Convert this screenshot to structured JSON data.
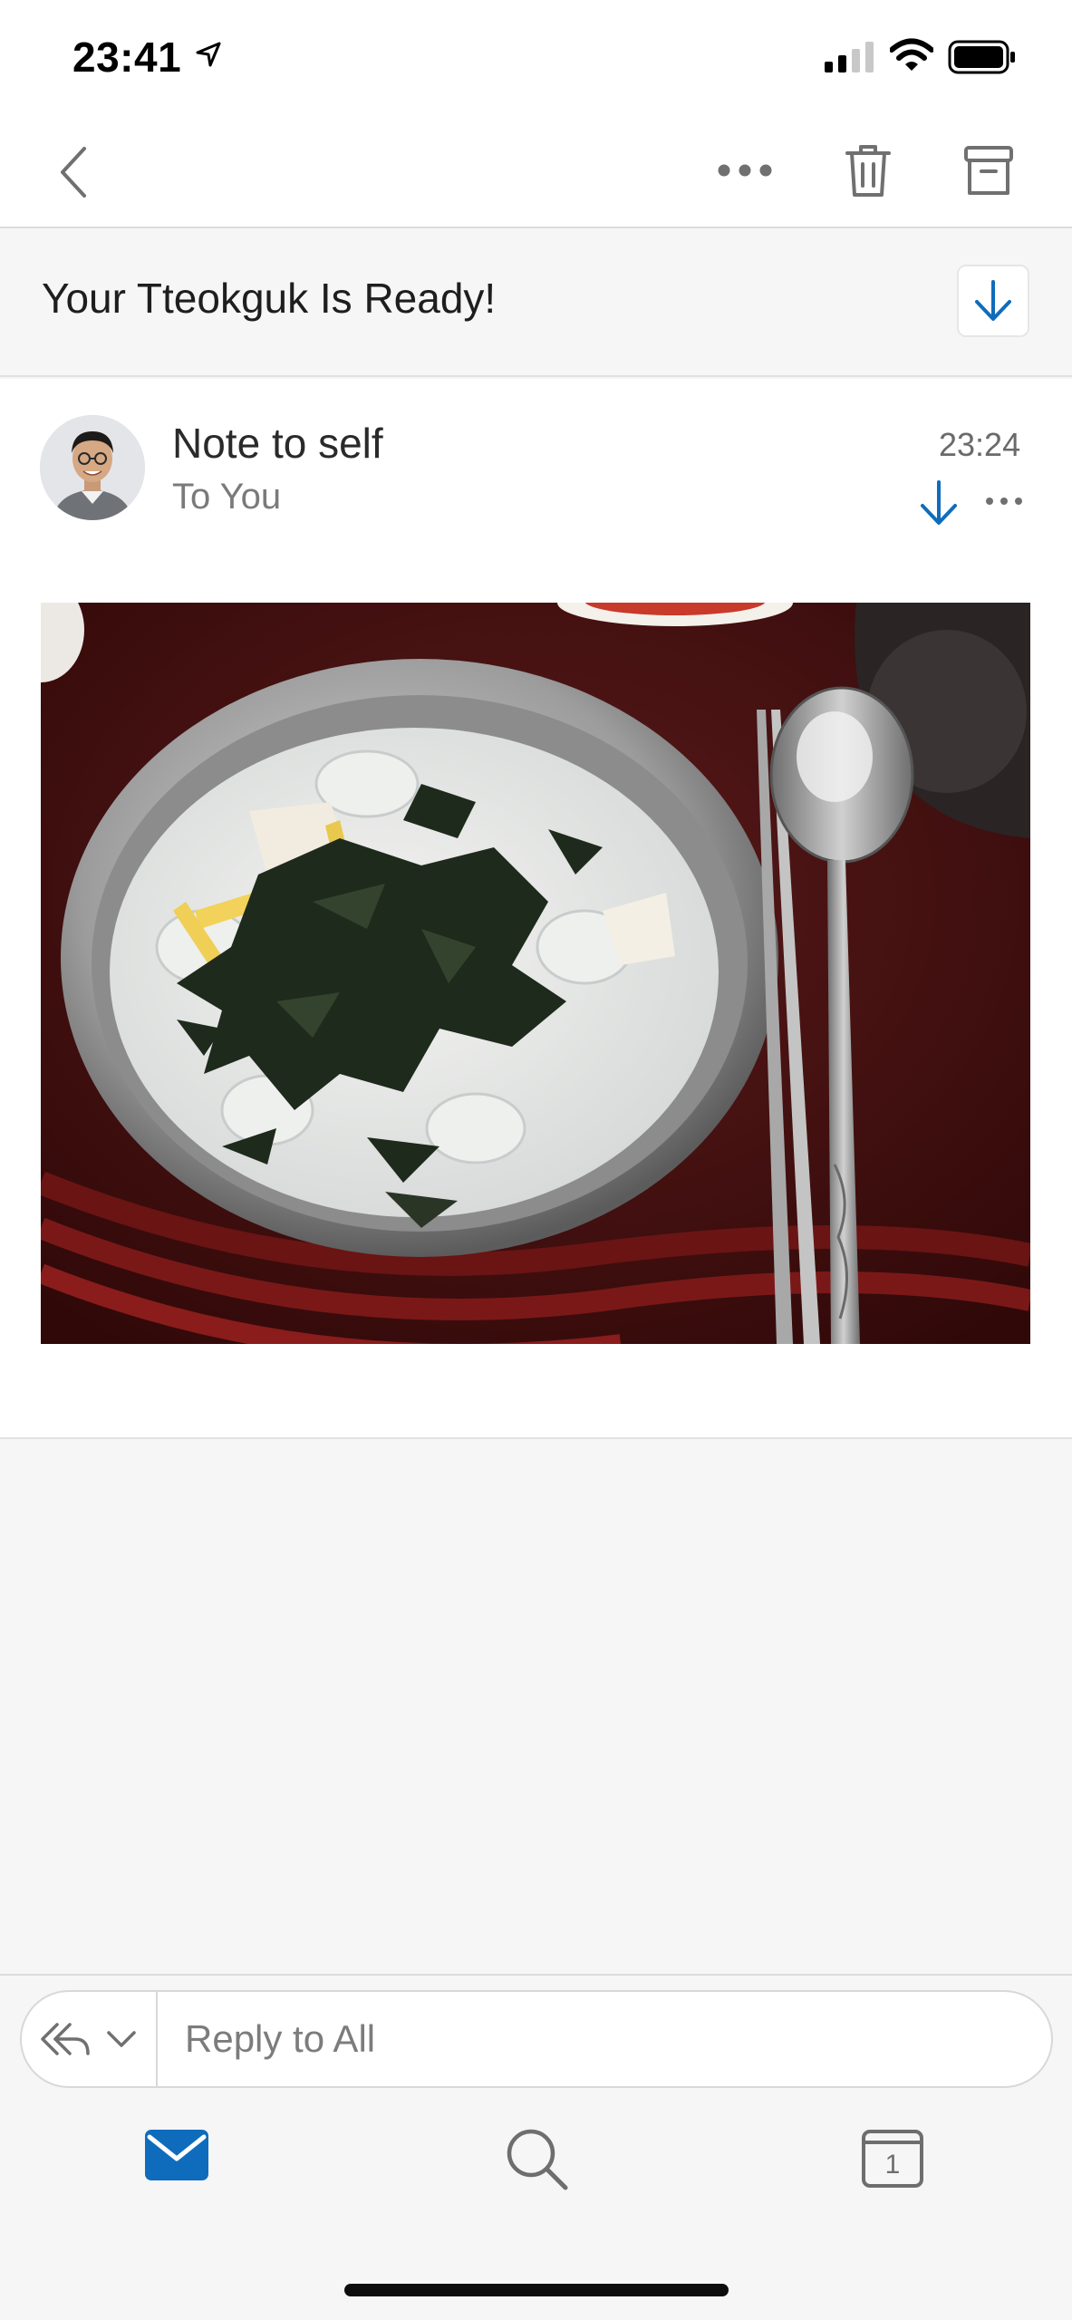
{
  "status_bar": {
    "time": "23:41"
  },
  "nav": {
    "back_icon": "chevron-left-icon",
    "more_icon": "more-horizontal-icon",
    "trash_icon": "trash-icon",
    "archive_icon": "archive-icon"
  },
  "email": {
    "subject": "Your Tteokguk Is Ready!",
    "sender": "Note to self",
    "recipient": "To You",
    "time": "23:24"
  },
  "reply": {
    "placeholder": "Reply to All"
  },
  "tabs": {
    "calendar_day": "1"
  },
  "colors": {
    "accent": "#0f6cbd",
    "icon_gray": "#6e6e6e"
  }
}
